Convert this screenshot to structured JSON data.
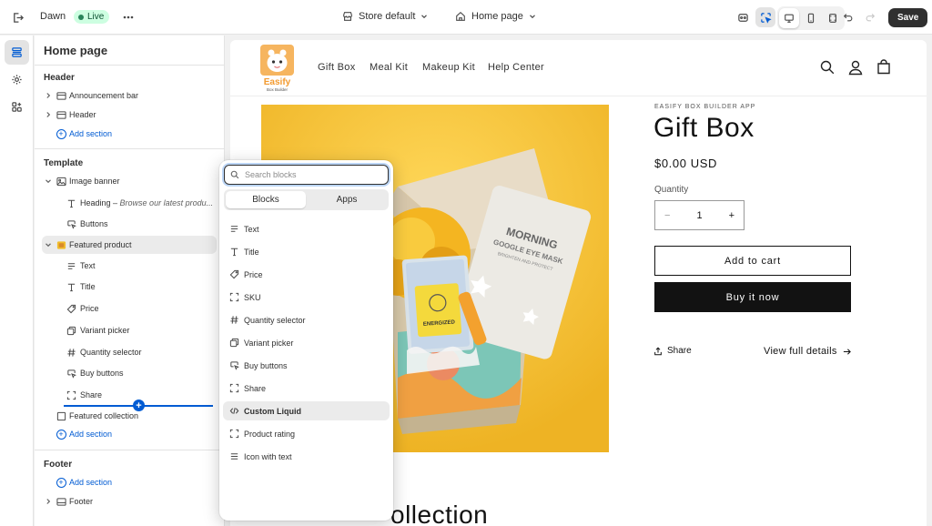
{
  "topbar": {
    "theme_name": "Dawn",
    "live_label": "Live",
    "store_selector": "Store default",
    "page_selector": "Home page",
    "save_label": "Save"
  },
  "sidebar": {
    "title": "Home page",
    "header_group": {
      "label": "Header",
      "items": [
        {
          "label": "Announcement bar",
          "icon": "layout-icon"
        },
        {
          "label": "Header",
          "icon": "layout-icon"
        }
      ],
      "add_label": "Add section"
    },
    "template_group": {
      "label": "Template",
      "image_banner": "Image banner",
      "heading_label": "Heading",
      "heading_preview": "Browse our latest produ...",
      "buttons_label": "Buttons",
      "featured_product": "Featured product",
      "blocks": [
        {
          "label": "Text",
          "icon": "text-icon"
        },
        {
          "label": "Title",
          "icon": "title-icon"
        },
        {
          "label": "Price",
          "icon": "price-tag-icon"
        },
        {
          "label": "Variant picker",
          "icon": "variant-icon"
        },
        {
          "label": "Quantity selector",
          "icon": "hashtag-icon"
        },
        {
          "label": "Buy buttons",
          "icon": "cursor-button-icon"
        },
        {
          "label": "Share",
          "icon": "share-frame-icon"
        }
      ],
      "featured_collection": "Featured collection",
      "add_label": "Add section"
    },
    "footer_group": {
      "label": "Footer",
      "add_label": "Add section",
      "footer_item": "Footer"
    }
  },
  "popover": {
    "search_placeholder": "Search blocks",
    "tabs": [
      "Blocks",
      "Apps"
    ],
    "items": [
      {
        "label": "Text",
        "icon": "text-icon"
      },
      {
        "label": "Title",
        "icon": "title-icon"
      },
      {
        "label": "Price",
        "icon": "price-tag-icon"
      },
      {
        "label": "SKU",
        "icon": "frame-icon"
      },
      {
        "label": "Quantity selector",
        "icon": "hashtag-icon"
      },
      {
        "label": "Variant picker",
        "icon": "variant-icon"
      },
      {
        "label": "Buy buttons",
        "icon": "cursor-button-icon"
      },
      {
        "label": "Share",
        "icon": "frame-icon"
      },
      {
        "label": "Custom Liquid",
        "icon": "code-icon"
      },
      {
        "label": "Product rating",
        "icon": "frame-icon"
      },
      {
        "label": "Icon with text",
        "icon": "list-icon"
      }
    ]
  },
  "store": {
    "logo_word": "Easify",
    "logo_sub": "Box Builder",
    "nav": [
      "Gift Box",
      "Meal Kit",
      "Makeup Kit",
      "Help Center"
    ],
    "vendor": "EASIFY BOX BUILDER APP",
    "product_title": "Gift Box",
    "price": "$0.00 USD",
    "quantity_label": "Quantity",
    "quantity_value": "1",
    "add_to_cart": "Add to cart",
    "buy_now": "Buy it now",
    "share": "Share",
    "view_details": "View full details",
    "collection_heading": "ollection",
    "image_text": {
      "mask_line1": "MORNING",
      "mask_line2": "GOOGLE EYE MASK",
      "mask_line3": "BRIGHTEN AND PROTECT",
      "sachet_label": "ENERGIZED"
    }
  },
  "colors": {
    "accent": "#005bd3",
    "live_bg": "#cdfee1",
    "product_bg": "#f1bd2c",
    "dark": "#121212"
  }
}
